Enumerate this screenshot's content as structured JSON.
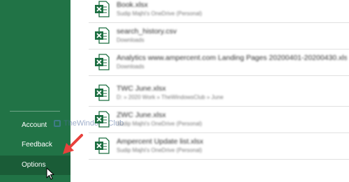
{
  "sidebar": {
    "items": [
      {
        "label": "Account"
      },
      {
        "label": "Feedback"
      },
      {
        "label": "Options"
      }
    ],
    "active": "Options"
  },
  "watermark": {
    "text": "TheWindowsClub"
  },
  "files": [
    {
      "name": "Book.xlsx",
      "path": "Sudip Majhi's OneDrive (Personal)"
    },
    {
      "name": "search_history.csv",
      "path": "Downloads"
    },
    {
      "name": "Analytics www.ampercent.com Landing Pages 20200401-20200430.xlsx",
      "path": "Downloads"
    },
    {
      "name": "TWC June.xlsx",
      "path": "D: » 2020 Work » TheWindowsClub » June"
    },
    {
      "name": "ZWC June.xlsx",
      "path": "Sudip Majhi's OneDrive (Personal)"
    },
    {
      "name": "Ampercent Update list.xlsx",
      "path": "Sudip Majhi's OneDrive (Personal)"
    }
  ],
  "colors": {
    "sidebar_bg": "#217346",
    "sidebar_active": "#1a5c37",
    "excel_green": "#1d6f42",
    "arrow_red": "#e8413c"
  },
  "icons": {
    "file": "excel-file-icon",
    "annotation": "red-arrow-icon",
    "pointer": "mouse-cursor-icon"
  }
}
